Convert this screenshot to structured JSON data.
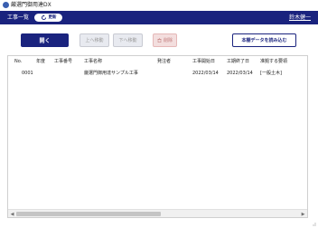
{
  "window": {
    "title": "厳選門御用達DX",
    "app_icon": "app-logo-icon"
  },
  "header": {
    "title": "工事一覧",
    "refresh_label": "更新",
    "refresh_icon": "refresh-icon",
    "user_name": "鈴木健一",
    "background": "#1a237e"
  },
  "toolbar": {
    "open_label": "開く",
    "move_up_label": "上へ移動",
    "move_down_label": "下へ移動",
    "delete_label": "削除",
    "delete_icon": "trash-icon",
    "import_label": "本棚データを読み込む"
  },
  "table": {
    "columns": [
      "No.",
      "年度",
      "工事番号",
      "工事名称",
      "発注者",
      "工事開始日",
      "工期終了日",
      "准拠する要領"
    ],
    "rows": [
      [
        "0001",
        "",
        "",
        "厳選門御用達サンプル工事",
        "",
        "2022/03/14",
        "2022/03/14",
        "[一般土木]"
      ]
    ]
  },
  "colors": {
    "accent": "#1a237e",
    "delete_bg": "#f3dede",
    "disabled_bg": "#e8eaf0"
  }
}
